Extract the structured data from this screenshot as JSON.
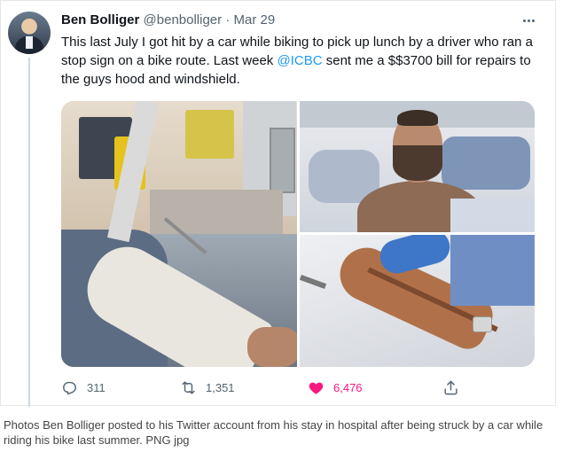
{
  "tweet": {
    "author_name": "Ben Bolliger",
    "author_handle": "@benbolliger",
    "separator": "·",
    "date": "Mar 29",
    "text_before_mention": "This last July I got hit by a car while biking to pick up lunch by a driver who ran a stop sign on a bike route.  Last week ",
    "mention": "@ICBC",
    "text_after_mention": " sent me a $$3700 bill for repairs to the guys hood and windshield."
  },
  "actions": {
    "reply_count": "311",
    "retweet_count": "1,351",
    "like_count": "6,476"
  },
  "icons": {
    "reply": "reply-icon",
    "retweet": "retweet-icon",
    "like": "heart-icon",
    "share": "share-icon",
    "more": "more-icon"
  },
  "colors": {
    "accent_blue": "#1d9bf0",
    "like_pink": "#f91880",
    "text_primary": "#0f1419",
    "text_secondary": "#536471"
  },
  "caption": "Photos Ben Bolliger posted to his Twitter account from his stay in hospital after being struck by a car while riding his bike last summer. PNG jpg"
}
